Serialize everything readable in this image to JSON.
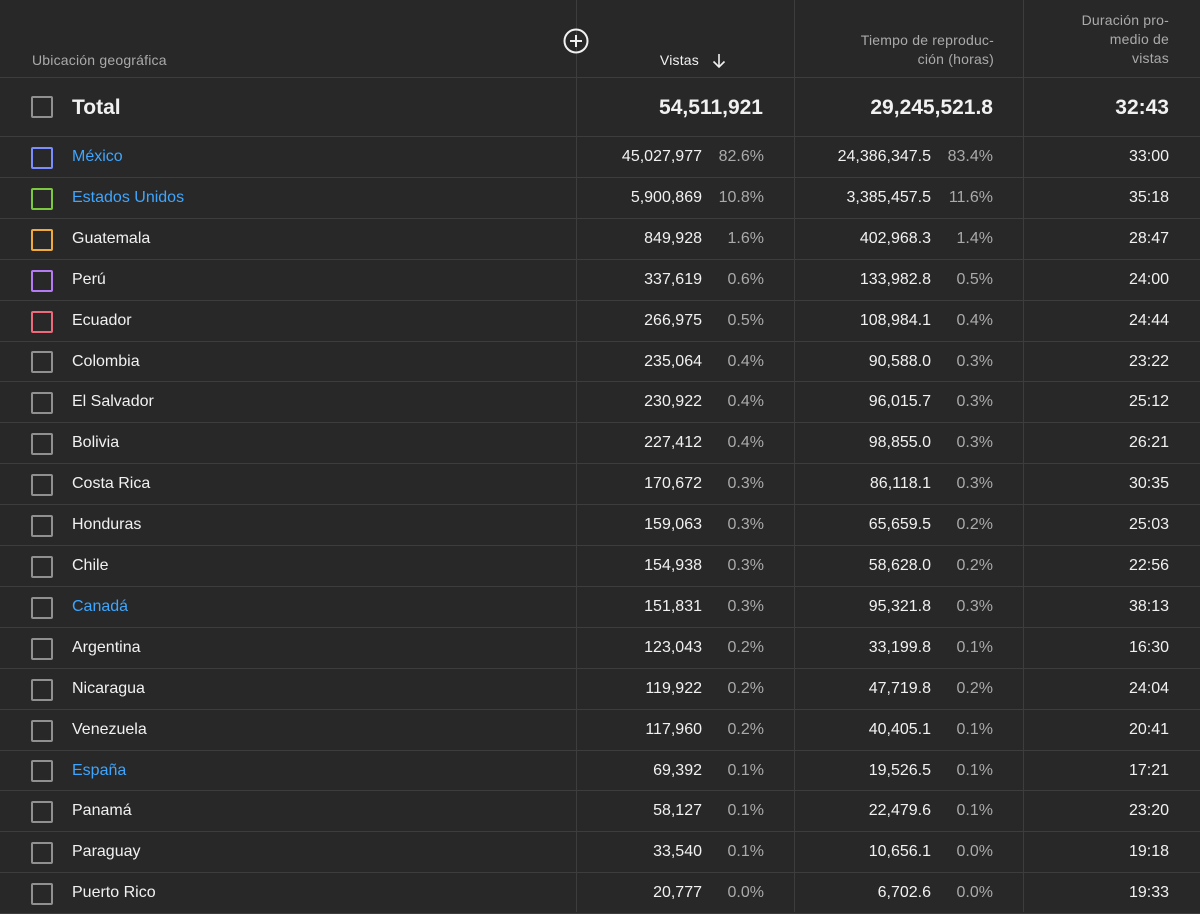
{
  "header": {
    "geo_label": "Ubicación geográfica",
    "views_label": "Vistas",
    "watch_label_line1": "Tiempo de reproduc-",
    "watch_label_line2": "ción (horas)",
    "avg_label_line1": "Duración pro-",
    "avg_label_line2": "medio de",
    "avg_label_line3": "vistas",
    "sort_icon": "arrow-down-icon",
    "add_icon": "plus-circle-icon"
  },
  "total": {
    "label": "Total",
    "views": "54,511,921",
    "watch": "29,245,521.8",
    "avg": "32:43"
  },
  "rows": [
    {
      "name": "México",
      "views": "45,027,977",
      "views_pct": "82.6%",
      "watch": "24,386,347.5",
      "watch_pct": "83.4%",
      "avg": "33:00",
      "color": "#7b8dff",
      "link": true
    },
    {
      "name": "Estados Unidos",
      "views": "5,900,869",
      "views_pct": "10.8%",
      "watch": "3,385,457.5",
      "watch_pct": "11.6%",
      "avg": "35:18",
      "color": "#7cc83f",
      "link": true
    },
    {
      "name": "Guatemala",
      "views": "849,928",
      "views_pct": "1.6%",
      "watch": "402,968.3",
      "watch_pct": "1.4%",
      "avg": "28:47",
      "color": "#f0a93b",
      "link": false
    },
    {
      "name": "Perú",
      "views": "337,619",
      "views_pct": "0.6%",
      "watch": "133,982.8",
      "watch_pct": "0.5%",
      "avg": "24:00",
      "color": "#b57bf5",
      "link": false
    },
    {
      "name": "Ecuador",
      "views": "266,975",
      "views_pct": "0.5%",
      "watch": "108,984.1",
      "watch_pct": "0.4%",
      "avg": "24:44",
      "color": "#ee6a7b",
      "link": false
    },
    {
      "name": "Colombia",
      "views": "235,064",
      "views_pct": "0.4%",
      "watch": "90,588.0",
      "watch_pct": "0.3%",
      "avg": "23:22",
      "color": "#909090",
      "link": false
    },
    {
      "name": "El Salvador",
      "views": "230,922",
      "views_pct": "0.4%",
      "watch": "96,015.7",
      "watch_pct": "0.3%",
      "avg": "25:12",
      "color": "#909090",
      "link": false
    },
    {
      "name": "Bolivia",
      "views": "227,412",
      "views_pct": "0.4%",
      "watch": "98,855.0",
      "watch_pct": "0.3%",
      "avg": "26:21",
      "color": "#909090",
      "link": false
    },
    {
      "name": "Costa Rica",
      "views": "170,672",
      "views_pct": "0.3%",
      "watch": "86,118.1",
      "watch_pct": "0.3%",
      "avg": "30:35",
      "color": "#909090",
      "link": false
    },
    {
      "name": "Honduras",
      "views": "159,063",
      "views_pct": "0.3%",
      "watch": "65,659.5",
      "watch_pct": "0.2%",
      "avg": "25:03",
      "color": "#909090",
      "link": false
    },
    {
      "name": "Chile",
      "views": "154,938",
      "views_pct": "0.3%",
      "watch": "58,628.0",
      "watch_pct": "0.2%",
      "avg": "22:56",
      "color": "#909090",
      "link": false
    },
    {
      "name": "Canadá",
      "views": "151,831",
      "views_pct": "0.3%",
      "watch": "95,321.8",
      "watch_pct": "0.3%",
      "avg": "38:13",
      "color": "#909090",
      "link": true
    },
    {
      "name": "Argentina",
      "views": "123,043",
      "views_pct": "0.2%",
      "watch": "33,199.8",
      "watch_pct": "0.1%",
      "avg": "16:30",
      "color": "#909090",
      "link": false
    },
    {
      "name": "Nicaragua",
      "views": "119,922",
      "views_pct": "0.2%",
      "watch": "47,719.8",
      "watch_pct": "0.2%",
      "avg": "24:04",
      "color": "#909090",
      "link": false
    },
    {
      "name": "Venezuela",
      "views": "117,960",
      "views_pct": "0.2%",
      "watch": "40,405.1",
      "watch_pct": "0.1%",
      "avg": "20:41",
      "color": "#909090",
      "link": false
    },
    {
      "name": "España",
      "views": "69,392",
      "views_pct": "0.1%",
      "watch": "19,526.5",
      "watch_pct": "0.1%",
      "avg": "17:21",
      "color": "#909090",
      "link": true
    },
    {
      "name": "Panamá",
      "views": "58,127",
      "views_pct": "0.1%",
      "watch": "22,479.6",
      "watch_pct": "0.1%",
      "avg": "23:20",
      "color": "#909090",
      "link": false
    },
    {
      "name": "Paraguay",
      "views": "33,540",
      "views_pct": "0.1%",
      "watch": "10,656.1",
      "watch_pct": "0.0%",
      "avg": "19:18",
      "color": "#909090",
      "link": false
    },
    {
      "name": "Puerto Rico",
      "views": "20,777",
      "views_pct": "0.0%",
      "watch": "6,702.6",
      "watch_pct": "0.0%",
      "avg": "19:33",
      "color": "#909090",
      "link": false
    }
  ]
}
